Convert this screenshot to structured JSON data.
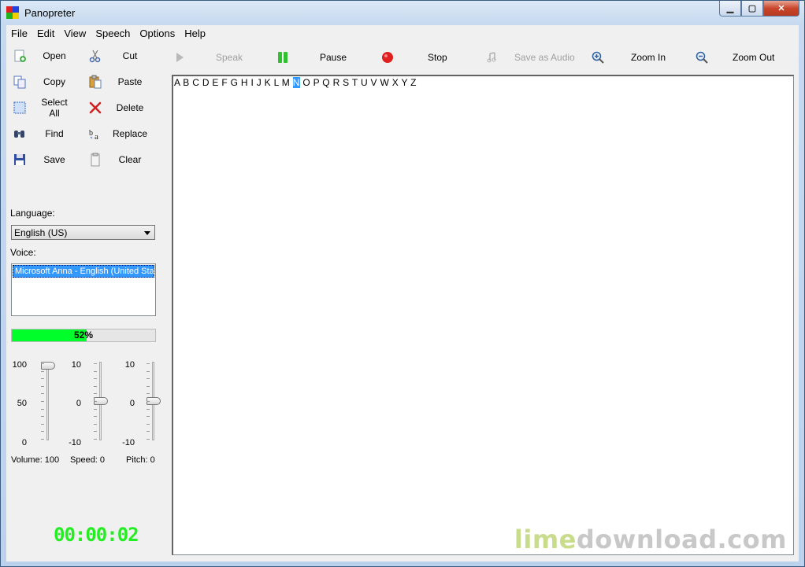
{
  "window": {
    "title": "Panopreter"
  },
  "menu": [
    "File",
    "Edit",
    "View",
    "Speech",
    "Options",
    "Help"
  ],
  "edit_buttons": {
    "open": "Open",
    "cut": "Cut",
    "copy": "Copy",
    "paste": "Paste",
    "select_all": "Select All",
    "delete": "Delete",
    "find": "Find",
    "replace": "Replace",
    "save": "Save",
    "clear": "Clear"
  },
  "toolbar": {
    "speak": "Speak",
    "pause": "Pause",
    "stop": "Stop",
    "save_audio": "Save as Audio",
    "zoom_in": "Zoom In",
    "zoom_out": "Zoom Out"
  },
  "language": {
    "label": "Language:",
    "selected": "English (US)"
  },
  "voice": {
    "label": "Voice:",
    "selected": "Microsoft Anna - English (United States)"
  },
  "progress": {
    "percent": 52,
    "text": "52%"
  },
  "sliders": {
    "volume": {
      "top": "100",
      "mid": "50",
      "bottom": "0",
      "caption": "Volume: 100",
      "value": 100
    },
    "speed": {
      "top": "10",
      "mid": "0",
      "bottom": "-10",
      "caption": "Speed: 0",
      "value": 0
    },
    "pitch": {
      "top": "10",
      "mid": "0",
      "bottom": "-10",
      "caption": "Pitch: 0",
      "value": 0
    }
  },
  "timer": "00:00:02",
  "editor": {
    "before": "A B C D E F G H I J K L M ",
    "highlight": "N",
    "after": " O P Q R S T U V W X Y Z"
  },
  "watermark": {
    "part1": "lime",
    "part2": "download.com"
  },
  "colors": {
    "progress": "#00ff2a",
    "timer": "#22ee22",
    "selection": "#3399ff"
  }
}
